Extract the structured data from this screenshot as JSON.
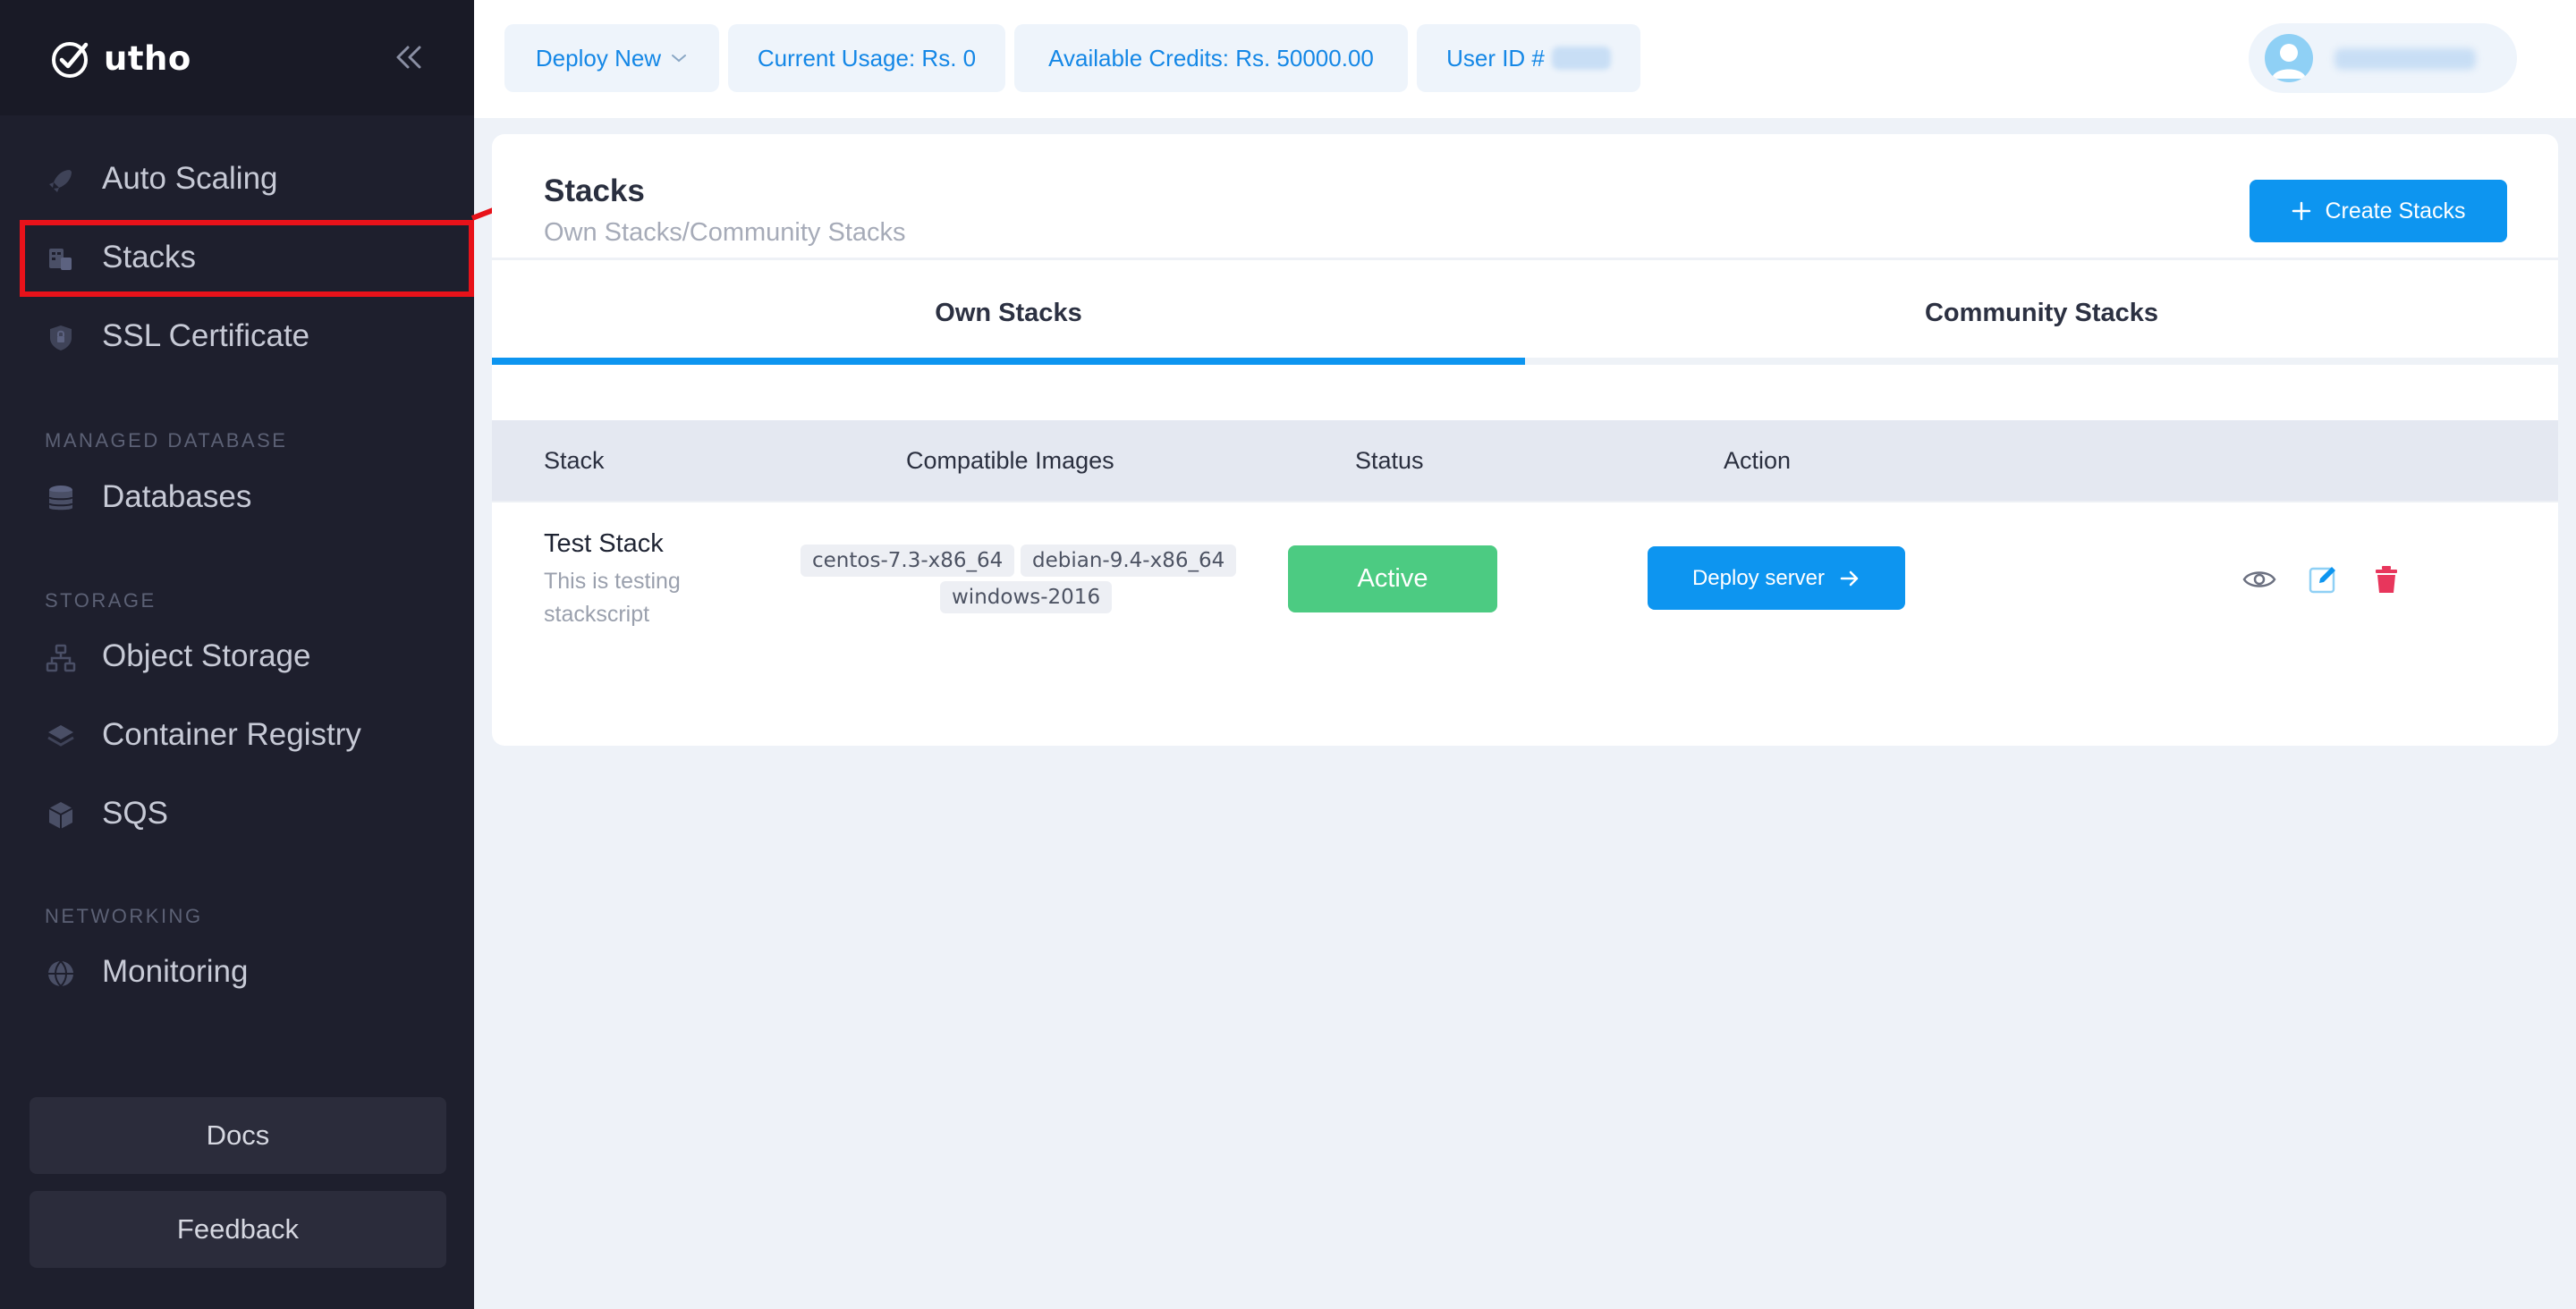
{
  "brand": {
    "name": "utho"
  },
  "sidebar": {
    "items": [
      {
        "label": "Auto Scaling",
        "icon": "rocket-icon"
      },
      {
        "label": "Stacks",
        "icon": "stacks-icon"
      },
      {
        "label": "SSL Certificate",
        "icon": "shield-icon"
      },
      {
        "label": "Databases",
        "icon": "database-icon"
      },
      {
        "label": "Object Storage",
        "icon": "object-storage-icon"
      },
      {
        "label": "Container Registry",
        "icon": "layers-icon"
      },
      {
        "label": "SQS",
        "icon": "hexagon-icon"
      },
      {
        "label": "Monitoring",
        "icon": "globe-icon"
      }
    ],
    "sections": {
      "managed_database": "MANAGED DATABASE",
      "storage": "STORAGE",
      "networking": "NETWORKING"
    },
    "docs_label": "Docs",
    "feedback_label": "Feedback"
  },
  "topbar": {
    "deploy_new": "Deploy New",
    "current_usage": "Current Usage: Rs. 0",
    "available_credits": "Available Credits: Rs. 50000.00",
    "user_id_label": "User ID #"
  },
  "page": {
    "title": "Stacks",
    "subtitle": "Own Stacks/Community Stacks",
    "create_button": "Create Stacks",
    "tabs": [
      {
        "label": "Own Stacks",
        "active": true
      },
      {
        "label": "Community Stacks",
        "active": false
      }
    ]
  },
  "table": {
    "columns": [
      "Stack",
      "Compatible Images",
      "Status",
      "Action"
    ],
    "rows": [
      {
        "name": "Test Stack",
        "description": "This is testing stackscript",
        "images": [
          "centos-7.3-x86_64",
          "debian-9.4-x86_64",
          "windows-2016"
        ],
        "status": "Active",
        "action": "Deploy server"
      }
    ]
  },
  "colors": {
    "accent": "#0d95f0",
    "success": "#4ccb82",
    "danger": "#e8365c",
    "sidebar": "#1e1f2d",
    "highlight": "#e8121a"
  }
}
